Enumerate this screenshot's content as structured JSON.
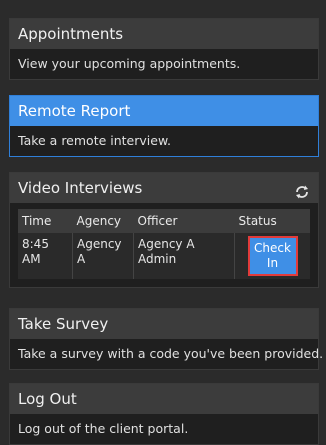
{
  "cards": {
    "appointments": {
      "title": "Appointments",
      "description": "View your upcoming appointments."
    },
    "remote_report": {
      "title": "Remote Report",
      "description": "Take a remote interview."
    },
    "video_interviews": {
      "title": "Video Interviews",
      "refresh_icon": "refresh-icon",
      "columns": [
        "Time",
        "Agency",
        "Officer",
        "Status"
      ],
      "rows": [
        {
          "time": "8:45 AM",
          "agency": "Agency A",
          "officer": "Agency A Admin",
          "status_button": "Check In"
        }
      ]
    },
    "take_survey": {
      "title": "Take Survey",
      "description": "Take a survey with a code you've been provided."
    },
    "log_out": {
      "title": "Log Out",
      "description": "Log out of the client portal."
    }
  },
  "colors": {
    "background": "#2b2b2b",
    "card_header": "#3c3c3c",
    "accent_blue": "#3f8fe6",
    "highlight_red": "#e23b3b"
  }
}
